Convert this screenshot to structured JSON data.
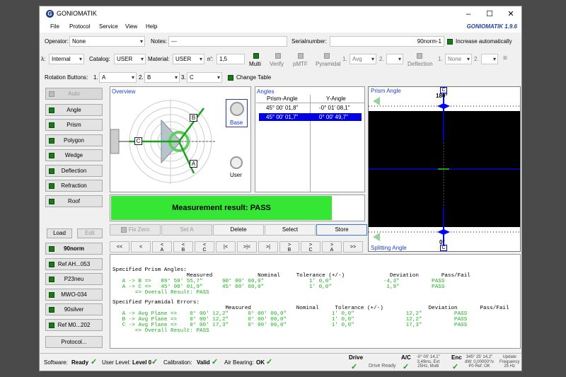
{
  "title": "GONIOMATIK",
  "brand": "GONIOMATIK 1.9.6",
  "menu": [
    "File",
    "Protocol",
    "Service",
    "View",
    "Help"
  ],
  "row1": {
    "operator_label": "Operator:",
    "operator_value": "None",
    "notes_label": "Notes:",
    "notes_value": "---",
    "serial_label": "Serialnumber:",
    "serial_value": "90norm-1",
    "increase_label": "Increase automatically"
  },
  "row2": {
    "lambda_label": "λ:",
    "lambda_value": "Internal",
    "catalog_label": "Catalog:",
    "catalog_value": "USER",
    "material_label": "Material:",
    "material_value": "USER",
    "n_label": "n':",
    "n_value": "1,5",
    "multi": "Multi",
    "verify": "Verify",
    "pmtf": "pMTF",
    "pyramidal": "Pyramidal",
    "p1": "1.",
    "avg": "Avg",
    "p2": "2.",
    "deflection": "Deflection",
    "d1": "1.",
    "none": "None",
    "d2": "2."
  },
  "row3": {
    "label": "Rotation Buttons:",
    "n1": "1.",
    "v1": "A",
    "n2": "2.",
    "v2": "B",
    "n3": "3.",
    "v3": "C",
    "change": "Change Table"
  },
  "left_buttons": {
    "auto": "Auto",
    "items": [
      "Angle",
      "Prism",
      "Polygon",
      "Wedge",
      "Deflection",
      "Refraction",
      "Roof"
    ],
    "load": "Load",
    "edit": "Edit",
    "presets": [
      "90norm",
      "Ref AH...053",
      "P23neu",
      "MWO-034",
      "90silver",
      "Ref M0...202"
    ],
    "protocol": "Protocol..."
  },
  "overview": {
    "title": "Overview",
    "base": "Base",
    "user": "User",
    "labels": [
      "B",
      "C",
      "A"
    ]
  },
  "angles": {
    "title": "Angles",
    "col1": "Prism-Angle",
    "col2": "Y-Angle",
    "rows": [
      [
        "45° 00' 01,8\"",
        "-0° 01' 08,1\""
      ],
      [
        "45° 00' 01,7\"",
        "0° 00' 49,7\""
      ]
    ]
  },
  "result": "Measurement result: PASS",
  "tabs": {
    "fixzero": "Fix Zero",
    "seta": "Set A",
    "delete": "Delete",
    "select": "Select",
    "store": "Store"
  },
  "nav": [
    [
      "<<",
      ""
    ],
    [
      "<",
      ""
    ],
    [
      "<",
      "A"
    ],
    [
      "<",
      "B"
    ],
    [
      "<",
      "C"
    ],
    [
      "|<",
      ""
    ],
    [
      ">|<",
      ""
    ],
    [
      ">|",
      ""
    ],
    [
      ">",
      "B"
    ],
    [
      ">",
      "C"
    ],
    [
      ">",
      "A"
    ],
    [
      ">>",
      ""
    ]
  ],
  "scope": {
    "top": "Prism Angle",
    "bottom": "Splitting Angle",
    "c_top": "C",
    "deg_top": "180°",
    "c_bot": "C",
    "deg_bot": "0°"
  },
  "report": {
    "h1": "Specified Prism Angles:",
    "c1": "                       Measured              Nominal     Tolerance (+/-)              Deviation       Pass/Fail",
    "l1": [
      "   A -> B =>   89° 59' 55,7\"      90° 00' 00,0\"              1' 0,0\"                -4,3\"          PASS",
      "   A -> C =>   45° 00' 01,9\"      45° 00' 00,0\"              1' 0,0\"                 1,9\"          PASS",
      "       => Overall Result: PASS"
    ],
    "h2": "Specified Pyramidal Errors:",
    "c2": "                                   Measured              Nominal     Tolerance (+/-)              Deviation       Pass/Fail",
    "l2": [
      "   A -> Avg Plane =>    0° 00' 12,2\"      0° 00' 00,0\"              1' 0,0\"                12,2\"          PASS",
      "   B -> Avg Plane =>    0° 00' 12,2\"      0° 00' 00,0\"              1' 0,0\"                12,2\"          PASS",
      "   C -> Avg Plane =>    0° 00' 17,3\"      0° 00' 00,0\"              1' 0,0\"                17,3\"          PASS",
      "       => Overall Result: PASS"
    ]
  },
  "status": {
    "software_label": "Software:",
    "software_value": "Ready",
    "userlevel_label": "User Level:",
    "userlevel_value": "Level 0",
    "calib_label": "Calibration:",
    "calib_value": "Valid",
    "air_label": "Air Bearing:",
    "air_value": "OK",
    "drive": "Drive",
    "drive_ready": "Drive Ready",
    "ac": "A/C",
    "ac_info": [
      "-0° 00' 14,1\"",
      "3,49ms, Ext",
      "25Hz, Multi"
    ],
    "enc": "Enc",
    "enc_info": [
      "345° 25' 14,2\"",
      "dW: 0,00000°/s",
      "P0 Ref: OK"
    ],
    "upd": [
      "Update",
      "Frequency",
      "25 Hz"
    ]
  }
}
